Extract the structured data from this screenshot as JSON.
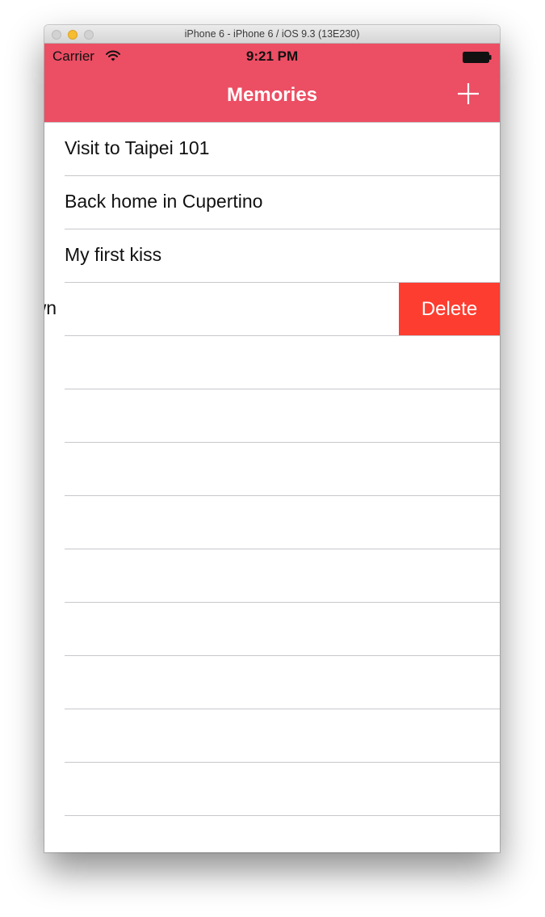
{
  "window": {
    "title": "iPhone 6 - iPhone 6 / iOS 9.3 (13E230)"
  },
  "status_bar": {
    "carrier": "Carrier",
    "time": "9:21 PM"
  },
  "nav_bar": {
    "title": "Memories",
    "add_icon": "plus-icon",
    "color": "#ec4e64"
  },
  "memories": [
    {
      "title": "Visit to Taipei 101"
    },
    {
      "title": "Back home in Cupertino"
    },
    {
      "title": "My first kiss"
    },
    {
      "title": "p in town",
      "swiped": true,
      "action_label": "Delete",
      "action_color": "#fd3d30"
    }
  ]
}
